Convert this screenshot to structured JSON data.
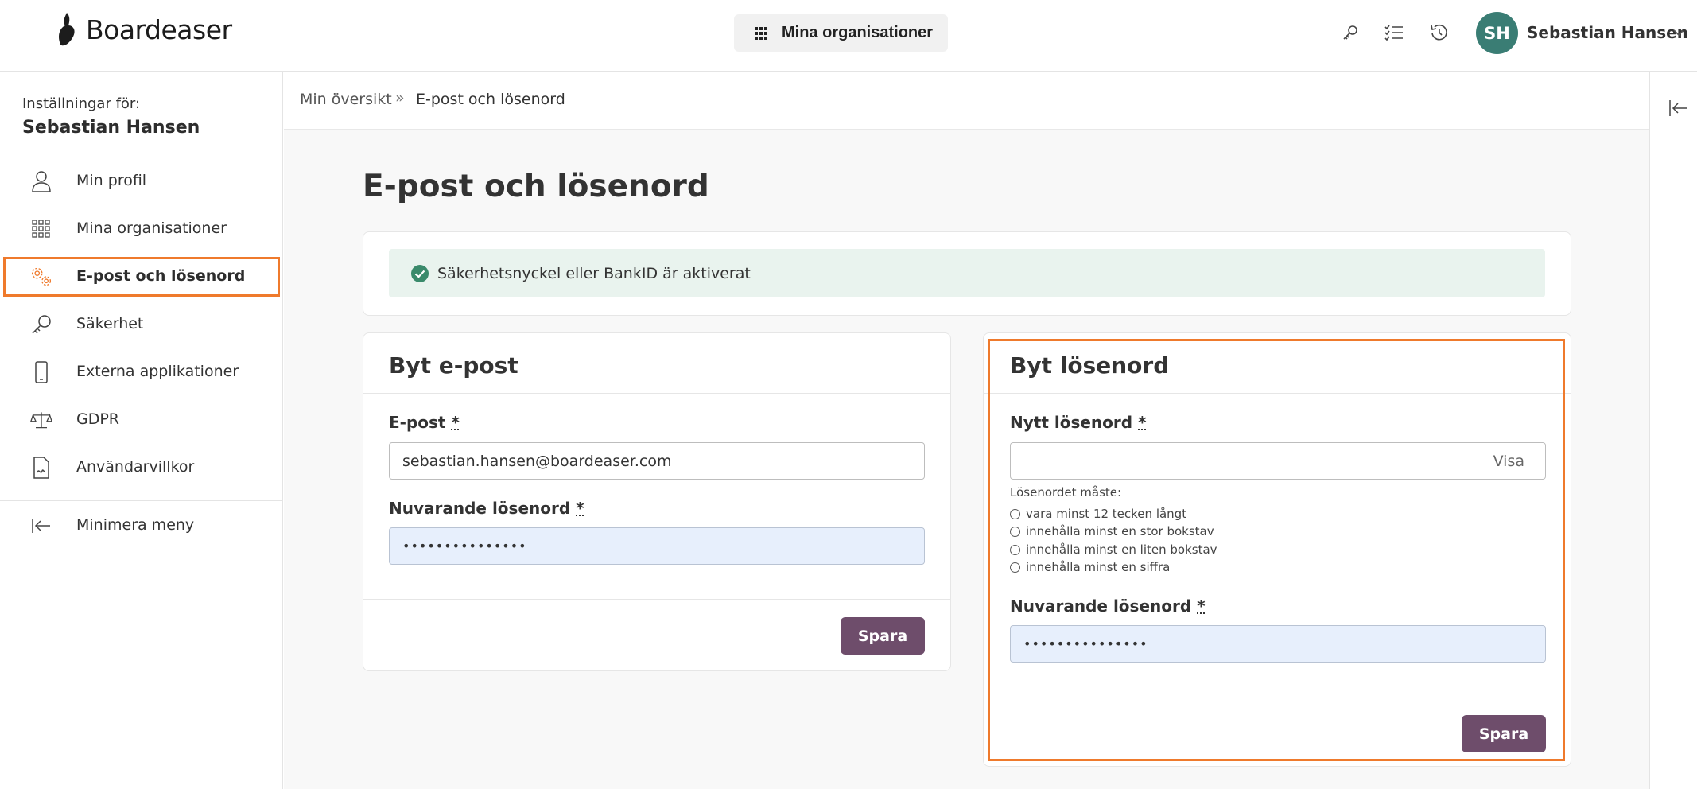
{
  "app": {
    "brand": "Boardeaser",
    "org_button_label": "Mina organisationer",
    "accent_color": "#ef7a2c",
    "button_color": "#6e4d6b",
    "avatar_color": "#3a7d74"
  },
  "user": {
    "initials": "SH",
    "name": "Sebastian Hansen"
  },
  "top_icons": [
    "key-icon",
    "checklist-icon",
    "history-icon",
    "chevron-down-icon"
  ],
  "sidebar": {
    "settings_for": "Inställningar för:",
    "user_name": "Sebastian Hansen",
    "items": [
      {
        "label": "Min profil",
        "icon": "person-icon"
      },
      {
        "label": "Mina organisationer",
        "icon": "grid-icon"
      },
      {
        "label": "E-post och lösenord",
        "icon": "gears-icon",
        "active": true
      },
      {
        "label": "Säkerhet",
        "icon": "key-icon"
      },
      {
        "label": "Externa applikationer",
        "icon": "phone-icon"
      },
      {
        "label": "GDPR",
        "icon": "scales-icon"
      },
      {
        "label": "Användarvillkor",
        "icon": "document-icon"
      }
    ],
    "minimize_label": "Minimera meny"
  },
  "breadcrumb": {
    "home": "Min översikt",
    "separator": "»",
    "current": "E-post och lösenord"
  },
  "page": {
    "title": "E-post och lösenord",
    "alert": "Säkerhetsnyckel eller BankID är aktiverat"
  },
  "email_card": {
    "title": "Byt e-post",
    "email_label": "E-post",
    "required_mark": "*",
    "email_value": "sebastian.hansen@boardeaser.com",
    "password_label": "Nuvarande lösenord",
    "password_value": "•••••••••••••••",
    "save_label": "Spara"
  },
  "password_card": {
    "title": "Byt lösenord",
    "new_password_label": "Nytt lösenord",
    "required_mark": "*",
    "new_password_value": "",
    "show_label": "Visa",
    "rules_intro": "Lösenordet måste:",
    "rules": [
      "vara minst 12 tecken långt",
      "innehålla minst en stor bokstav",
      "innehålla minst en liten bokstav",
      "innehålla minst en siffra"
    ],
    "current_password_label": "Nuvarande lösenord",
    "current_password_value": "•••••••••••••••",
    "save_label": "Spara"
  }
}
